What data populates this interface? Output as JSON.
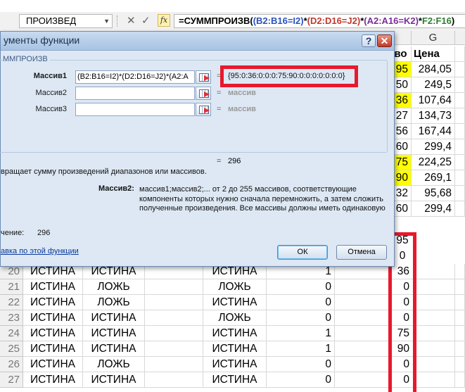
{
  "formula_bar": {
    "name_box": "ПРОИЗВЕД",
    "cancel_icon": "✕",
    "enter_icon": "✓",
    "fx_label": "fx",
    "formula_parts": [
      "=СУММПРОИЗВ(",
      "(B2:B16=I2)",
      "*",
      "(D2:D16=J2)",
      "*",
      "(A2:A16=K2)",
      "*",
      "F2:F16",
      ")"
    ]
  },
  "sheet": {
    "col_headers": {
      "f": "",
      "g": "G"
    },
    "header_row": {
      "f": "во",
      "g": "Цена"
    },
    "upper_rows": [
      {
        "f": "95",
        "g": "284,05",
        "f_yellow": true
      },
      {
        "f": "50",
        "g": "249,5",
        "f_yellow": false
      },
      {
        "f": "36",
        "g": "107,64",
        "f_yellow": true
      },
      {
        "f": "27",
        "g": "134,73",
        "f_yellow": false
      },
      {
        "f": "56",
        "g": "167,44",
        "f_yellow": false
      },
      {
        "f": "60",
        "g": "299,4",
        "f_yellow": false
      },
      {
        "f": "75",
        "g": "224,25",
        "f_yellow": true
      },
      {
        "f": "90",
        "g": "269,1",
        "f_yellow": true
      },
      {
        "f": "32",
        "g": "95,68",
        "f_yellow": false
      },
      {
        "f": "60",
        "g": "299,4",
        "f_yellow": false
      }
    ],
    "helper_values_near_dialog": [
      "95",
      "0"
    ],
    "lower_rows": [
      {
        "row": "20",
        "a": "ИСТИНА",
        "b": "ИСТИНА",
        "d": "ИСТИНА",
        "e": "1",
        "h": "36"
      },
      {
        "row": "21",
        "a": "ИСТИНА",
        "b": "ЛОЖЬ",
        "d": "ЛОЖЬ",
        "e": "0",
        "h": "0"
      },
      {
        "row": "22",
        "a": "ИСТИНА",
        "b": "ЛОЖЬ",
        "d": "ИСТИНА",
        "e": "0",
        "h": "0"
      },
      {
        "row": "23",
        "a": "ИСТИНА",
        "b": "ИСТИНА",
        "d": "ЛОЖЬ",
        "e": "0",
        "h": "0"
      },
      {
        "row": "24",
        "a": "ИСТИНА",
        "b": "ИСТИНА",
        "d": "ИСТИНА",
        "e": "1",
        "h": "75"
      },
      {
        "row": "25",
        "a": "ИСТИНА",
        "b": "ИСТИНА",
        "d": "ИСТИНА",
        "e": "1",
        "h": "90"
      },
      {
        "row": "26",
        "a": "ИСТИНА",
        "b": "ЛОЖЬ",
        "d": "ИСТИНА",
        "e": "0",
        "h": "0"
      },
      {
        "row": "27",
        "a": "ИСТИНА",
        "b": "ИСТИНА",
        "d": "ИСТИНА",
        "e": "0",
        "h": "0"
      }
    ]
  },
  "dialog": {
    "title": "ументы функции",
    "help_btn": "?",
    "close_btn": "✕",
    "group_title": "ММПРОИЗВ",
    "args": [
      {
        "label": "Массив1",
        "value": "(B2:B16=I2)*(D2:D16=J2)*(A2:A",
        "result": "{95:0:36:0:0:0:75:90:0:0:0:0:0:0:0}",
        "bold": true
      },
      {
        "label": "Массив2",
        "value": "",
        "result": "массив",
        "bold": false
      },
      {
        "label": "Массив3",
        "value": "",
        "result": "массив",
        "bold": false
      }
    ],
    "equals": "=",
    "formula_result_inline": "296",
    "function_description": "вращает сумму произведений диапазонов или массивов.",
    "arg_help_label": "Массив2:",
    "arg_help_text": "массив1;массив2;... от 2 до 255 массивов, соответствующие компоненты которых нужно сначала перемножить, а затем сложить полученные произведения. Все массивы должны иметь одинаковую",
    "formula_result_label": "чение:",
    "formula_result_value": "296",
    "help_link": "авка по этой функции",
    "ok_label": "ОК",
    "cancel_label": "Отмена"
  },
  "colors": {
    "highlight_red": "#e8192c",
    "cell_yellow": "#ffff00",
    "dialog_bg": "#dde8f4",
    "title_bar": "#a8c3e3"
  }
}
